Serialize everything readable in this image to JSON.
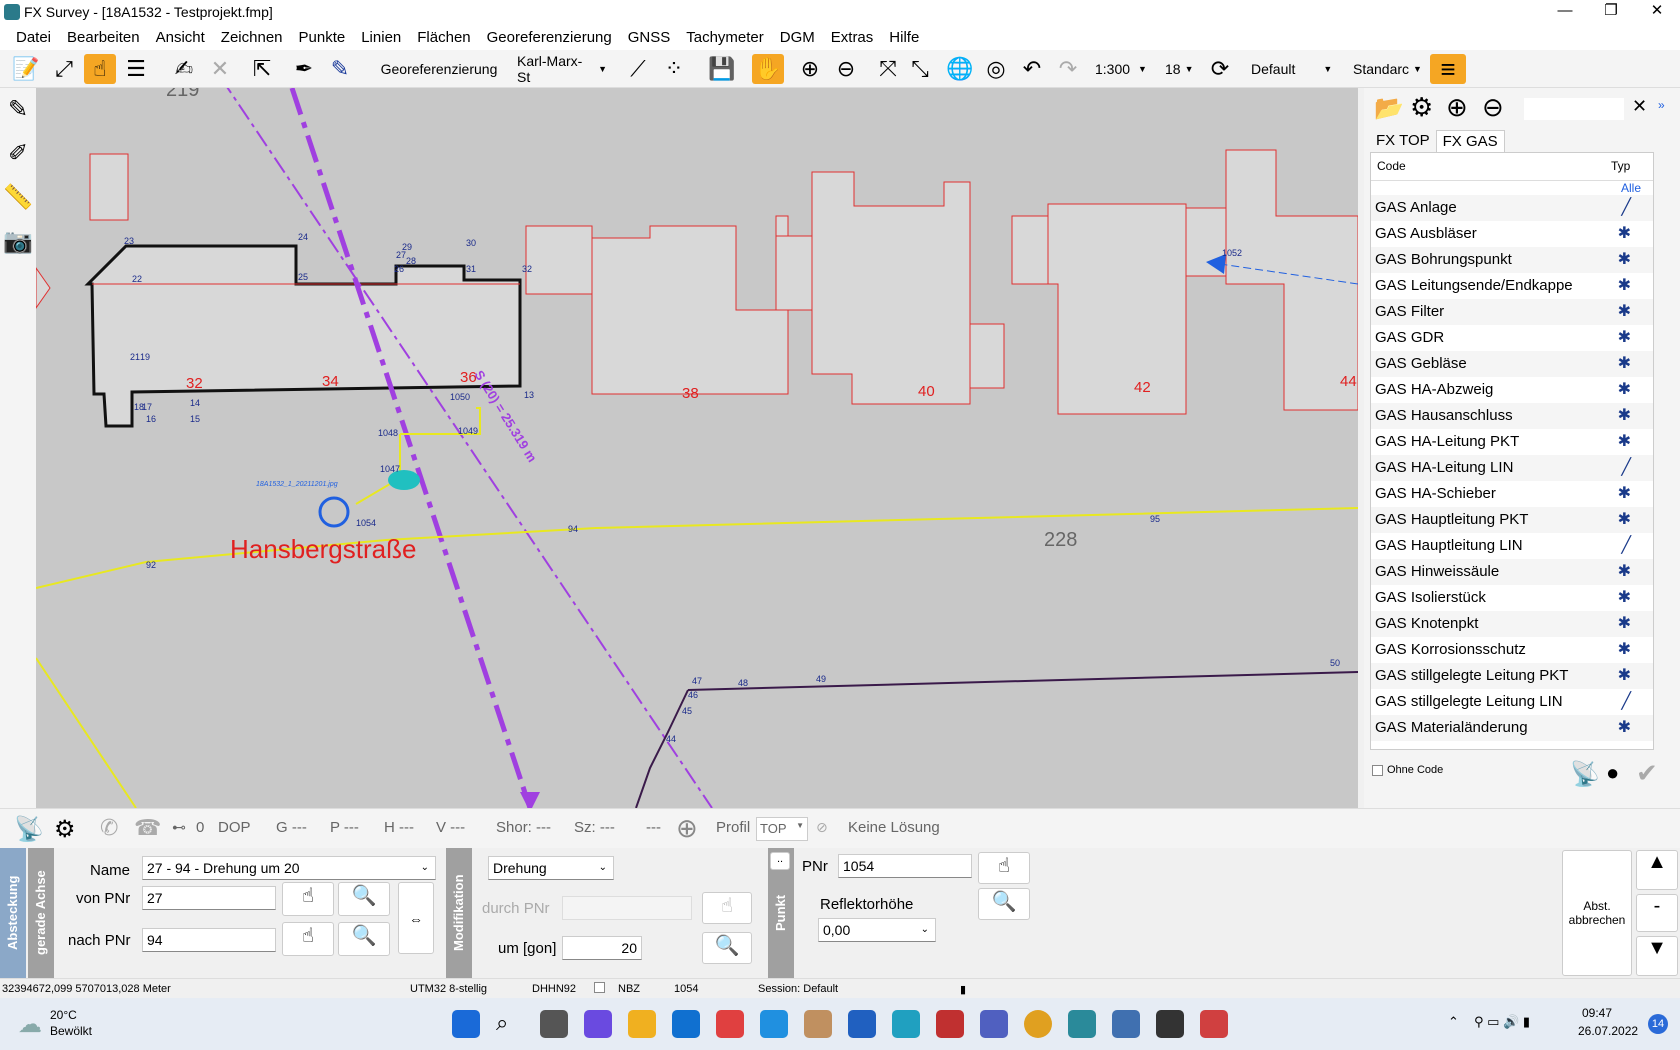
{
  "window": {
    "title": "FX Survey - [18A1532 - Testprojekt.fmp]",
    "minimize": "—",
    "maximize": "❐",
    "close": "✕"
  },
  "menu": [
    "Datei",
    "Bearbeiten",
    "Ansicht",
    "Zeichnen",
    "Punkte",
    "Linien",
    "Flächen",
    "Georeferenzierung",
    "GNSS",
    "Tachymeter",
    "DGM",
    "Extras",
    "Hilfe"
  ],
  "toolbar": {
    "georef_label": "Georeferenzierung",
    "street_combo": "Karl-Marx-St",
    "scale": "1:300",
    "zoom_level": "18",
    "style_combo": "Default",
    "standard_combo": "Standarc"
  },
  "map": {
    "labels": {
      "n219": "219",
      "n228": "228",
      "street": "Hansbergstraße",
      "parcel32": "32",
      "parcel34": "34",
      "parcel36": "36",
      "parcel38": "38",
      "parcel40": "40",
      "parcel42": "42",
      "parcel44": "44",
      "axis": "S (20) = 25.319 m",
      "photo": "18A1532_1_20211201.jpg"
    },
    "points": [
      "23",
      "24",
      "25",
      "29",
      "30",
      "31",
      "32",
      "22",
      "21",
      "19",
      "18",
      "17",
      "16",
      "15",
      "14",
      "28",
      "26",
      "27",
      "13",
      "1050",
      "1048",
      "1049",
      "1047",
      "1052",
      "95",
      "94",
      "92",
      "47",
      "46",
      "48",
      "49",
      "50",
      "45",
      "44",
      "1054"
    ]
  },
  "panel": {
    "tabs": [
      "FX TOP",
      "FX GAS"
    ],
    "head_code": "Code",
    "head_typ": "Typ",
    "filter": "Alle",
    "codes": [
      {
        "name": "GAS Anlage",
        "typ": "╱"
      },
      {
        "name": "GAS Ausbläser",
        "typ": "✱"
      },
      {
        "name": "GAS Bohrungspunkt",
        "typ": "✱"
      },
      {
        "name": "GAS Leitungsende/Endkappe",
        "typ": "✱"
      },
      {
        "name": "GAS Filter",
        "typ": "✱"
      },
      {
        "name": "GAS GDR",
        "typ": "✱"
      },
      {
        "name": "GAS Gebläse",
        "typ": "✱"
      },
      {
        "name": "GAS HA-Abzweig",
        "typ": "✱"
      },
      {
        "name": "GAS Hausanschluss",
        "typ": "✱"
      },
      {
        "name": "GAS HA-Leitung PKT",
        "typ": "✱"
      },
      {
        "name": "GAS HA-Leitung LIN",
        "typ": "╱"
      },
      {
        "name": "GAS HA-Schieber",
        "typ": "✱"
      },
      {
        "name": "GAS Hauptleitung PKT",
        "typ": "✱"
      },
      {
        "name": "GAS Hauptleitung LIN",
        "typ": "╱"
      },
      {
        "name": "GAS Hinweissäule",
        "typ": "✱"
      },
      {
        "name": "GAS Isolierstück",
        "typ": "✱"
      },
      {
        "name": "GAS Knotenpkt",
        "typ": "✱"
      },
      {
        "name": "GAS Korrosionsschutz",
        "typ": "✱"
      },
      {
        "name": "GAS stillgelegte Leitung PKT",
        "typ": "✱"
      },
      {
        "name": "GAS stillgelegte Leitung LIN",
        "typ": "╱"
      },
      {
        "name": "GAS Materialänderung",
        "typ": "✱"
      }
    ],
    "ohne_code": "Ohne Code"
  },
  "status": {
    "sats": "0",
    "dop": "DOP",
    "g": "G ---",
    "p": "P ---",
    "h": "H ---",
    "v": "V ---",
    "shor": "Shor: ---",
    "sz": "Sz: ---",
    "dash": "---",
    "profil": "Profil",
    "profil_val": "TOP",
    "loesung": "Keine Lösung"
  },
  "stakeout": {
    "tab1": "Absteckung",
    "tab2": "gerade Achse",
    "name_label": "Name",
    "name_val": "27 - 94 - Drehung um 20",
    "von_label": "von PNr",
    "von_val": "27",
    "nach_label": "nach PNr",
    "nach_val": "94",
    "mod_tab": "Modifikation",
    "mod_combo": "Drehung",
    "durch_label": "durch PNr",
    "um_label": "um [gon]",
    "um_val": "20",
    "punkt_tab": "Punkt",
    "pnr_label": "PNr",
    "pnr_val": "1054",
    "refl_label": "Reflektorhöhe",
    "refl_val": "0,00",
    "abbrechen": "Abst. abbrechen",
    "minus": "-",
    "dots": ".."
  },
  "footer": {
    "coords": "32394672,099 5707013,028 Meter",
    "crs": "UTM32 8-stellig",
    "height": "DHHN92",
    "nbz": "NBZ",
    "pnr": "1054",
    "session": "Session: Default"
  },
  "taskbar": {
    "temp": "20°C",
    "weather": "Bewölkt",
    "time": "09:47",
    "date": "26.07.2022",
    "badge": "14"
  }
}
